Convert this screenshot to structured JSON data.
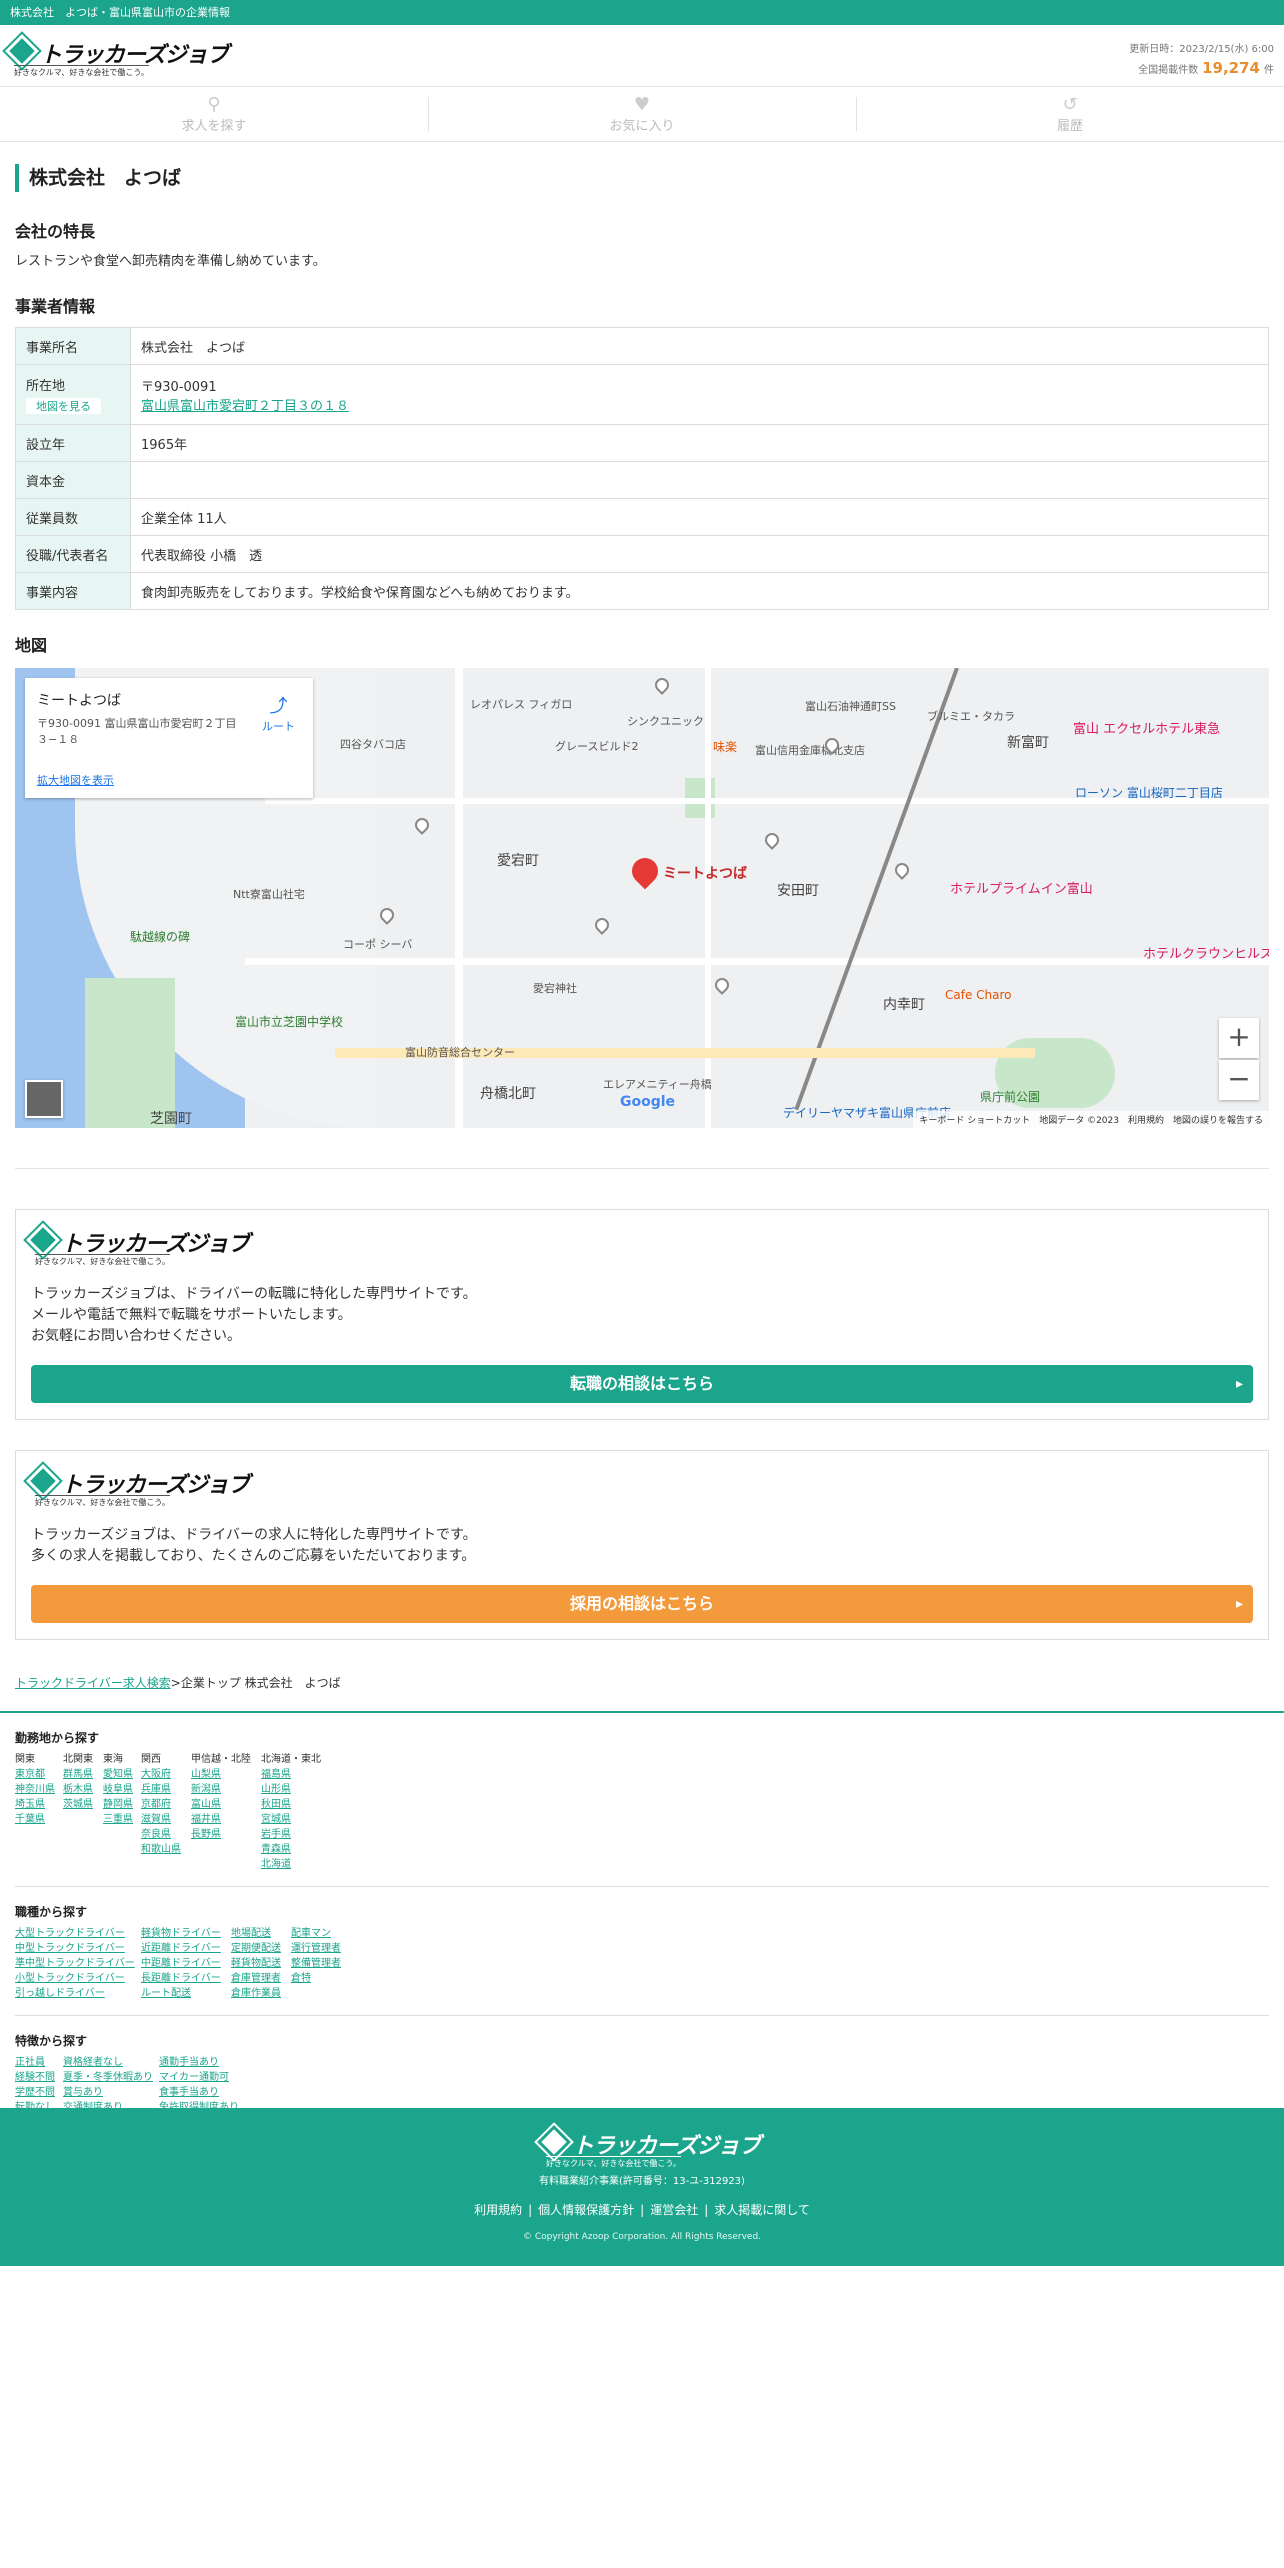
{
  "topbar": {
    "text": "株式会社　よつば・富山県富山市の企業情報"
  },
  "header": {
    "logo_title": "トラッカーズジョブ",
    "logo_sub": "好きなクルマ、好きな会社で働こう。",
    "updated": "更新日時：2023/2/15(水) 6:00",
    "count_label": "全国掲載件数",
    "count_value": "19,274",
    "count_unit": "件"
  },
  "nav": [
    {
      "label": "求人を探す",
      "icon": "search-icon"
    },
    {
      "label": "お気に入り",
      "icon": "heart-icon"
    },
    {
      "label": "履歴",
      "icon": "history-icon"
    }
  ],
  "company": {
    "name": "株式会社　よつば",
    "features_heading": "会社の特長",
    "features_text": "レストランや食堂へ卸売精肉を準備し納めています。",
    "info_heading": "事業者情報",
    "rows": [
      {
        "label": "事業所名",
        "value": "株式会社　よつば"
      },
      {
        "label": "所在地",
        "zip": "〒930-0091",
        "map_button": "地図を見る",
        "address_link": "富山県富山市愛宕町２丁目３の１８"
      },
      {
        "label": "設立年",
        "value": "1965年"
      },
      {
        "label": "資本金",
        "value": ""
      },
      {
        "label": "従業員数",
        "value": "企業全体 11人"
      },
      {
        "label": "役職/代表者名",
        "value": "代表取締役 小橋　透"
      },
      {
        "label": "事業内容",
        "value": "食肉卸売販売をしております。学校給食や保育園などへも納めております。"
      }
    ]
  },
  "map": {
    "heading": "地図",
    "card_title": "ミートよつば",
    "card_address": "〒930-0091 富山県富山市愛宕町２丁目３−１８",
    "card_route": "ルート",
    "card_link": "拡大地図を表示",
    "pin_label": "ミートよつば",
    "labels": [
      {
        "t": "レオパレス フィガロ"
      },
      {
        "t": "シンクユニック"
      },
      {
        "t": "富山石油神通町SS"
      },
      {
        "t": "ブルミエ・タカラ"
      },
      {
        "t": "富山 エクセルホテル東急"
      },
      {
        "t": "新富町"
      },
      {
        "t": "四谷タバコ店"
      },
      {
        "t": "グレースビルド2"
      },
      {
        "t": "味楽"
      },
      {
        "t": "富山信用金庫橋北支店"
      },
      {
        "t": "ローソン 富山桜町二丁目店"
      },
      {
        "t": "富山桜町二丁目店"
      },
      {
        "t": "愛宕町"
      },
      {
        "t": "安田町"
      },
      {
        "t": "ホテルプライムイン富山"
      },
      {
        "t": "Ntt寮富山社宅"
      },
      {
        "t": "駄越線の碑"
      },
      {
        "t": "愛宕神社"
      },
      {
        "t": "コーポ シーバ"
      },
      {
        "t": "富山市立芝園中学校"
      },
      {
        "t": "ホテルクラウンヒルズ富山"
      },
      {
        "t": "Cafe Charo"
      },
      {
        "t": "内幸町"
      },
      {
        "t": "県庁前公園"
      },
      {
        "t": "舟橋北町"
      },
      {
        "t": "芝園町"
      },
      {
        "t": "富山防音総合センター"
      },
      {
        "t": "エレアメニティー舟橋"
      },
      {
        "t": "デイリーヤマザキ富山県庁前店"
      }
    ],
    "attribution": "キーボード ショートカット　地図データ ©2023　利用規約　地図の誤りを報告する",
    "zoom_in": "+",
    "zoom_out": "−",
    "google": "Google"
  },
  "promos": [
    {
      "text": [
        "トラッカーズジョブは、ドライバーの転職に特化した専門サイトです。",
        "メールや電話で無料で転職をサポートいたします。",
        "お気軽にお問い合わせください。"
      ],
      "button": "転職の相談はこちら"
    },
    {
      "text": [
        "トラッカーズジョブは、ドライバーの求人に特化した専門サイトです。",
        "多くの求人を掲載しており、たくさんのご応募をいただいております。"
      ],
      "button": "採用の相談はこちら"
    }
  ],
  "breadcrumb": {
    "link": "トラックドライバー求人検索",
    "rest": ">企業トップ 株式会社　よつば"
  },
  "search": {
    "area_heading": "勤務地から探す",
    "area_cols": [
      {
        "title": "関東",
        "items": [
          "東京都",
          "神奈川県",
          "埼玉県",
          "千葉県"
        ]
      },
      {
        "title": "北関東",
        "items": [
          "群馬県",
          "栃木県",
          "茨城県"
        ]
      },
      {
        "title": "東海",
        "items": [
          "愛知県",
          "岐阜県",
          "静岡県",
          "三重県"
        ]
      },
      {
        "title": "関西",
        "items": [
          "大阪府",
          "兵庫県",
          "京都府",
          "滋賀県",
          "奈良県",
          "和歌山県"
        ]
      },
      {
        "title": "甲信越・北陸",
        "items": [
          "山梨県",
          "新潟県",
          "富山県",
          "福井県",
          "長野県"
        ]
      },
      {
        "title": "北海道・東北",
        "items": [
          "福島県",
          "山形県",
          "秋田県",
          "宮城県",
          "岩手県",
          "青森県",
          "北海道"
        ]
      }
    ],
    "job_heading": "職種から探す",
    "job_cols": [
      [
        "大型トラックドライバー",
        "中型トラックドライバー",
        "準中型トラックドライバー",
        "小型トラックドライバー",
        "引っ越しドライバー"
      ],
      [
        "軽貨物ドライバー",
        "近距離ドライバー",
        "中距離ドライバー",
        "長距離ドライバー",
        "ルート配送"
      ],
      [
        "地場配送",
        "定期便配送",
        "軽貨物配送",
        "倉庫管理者",
        "倉庫作業員"
      ],
      [
        "配車マン",
        "運行管理者",
        "整備管理者",
        "倉特"
      ]
    ],
    "feature_heading": "特徴から探す",
    "feature_cols": [
      [
        "正社員",
        "経験不問",
        "学歴不問",
        "転勤なし"
      ],
      [
        "資格経者なし",
        "夏季・冬季休暇あり",
        "賞与あり",
        "交通制度あり"
      ],
      [
        "通勤手当あり",
        "マイカー通勤可",
        "食事手当あり",
        "免許取得制度あり"
      ]
    ]
  },
  "footer": {
    "logo_title": "トラッカーズジョブ",
    "logo_sub": "好きなクルマ、好きな会社で働こう。",
    "license": "有料職業紹介事業(許可番号：13-ユ-312923)",
    "links": [
      "利用規約",
      "個人情報保護方針",
      "運営会社",
      "求人掲載に関して"
    ],
    "copyright": "© Copyright Azoop Corporation. All Rights Reserved."
  }
}
